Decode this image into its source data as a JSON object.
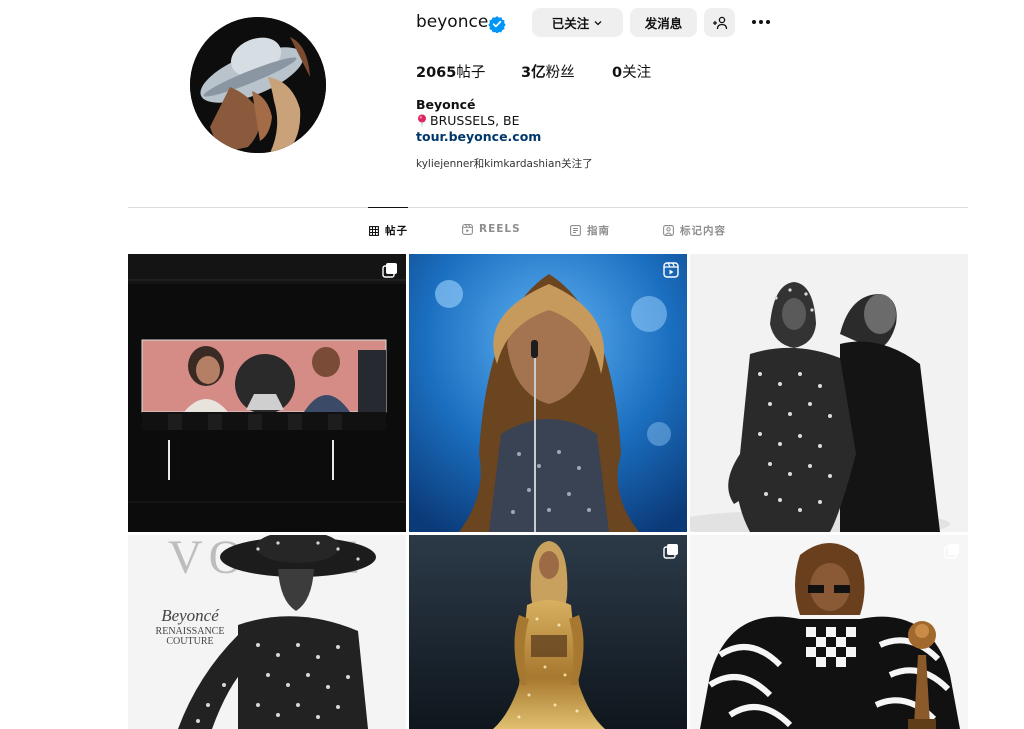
{
  "profile": {
    "username": "beyonce",
    "following_button": "已关注",
    "message_button": "发消息",
    "stats": {
      "posts": "2065",
      "posts_label": "帖子",
      "followers": "3亿",
      "followers_label": "粉丝",
      "following": "0",
      "following_label": "关注"
    },
    "full_name": "Beyoncé",
    "location": "BRUSSELS, BE",
    "link": "tour.beyonce.com",
    "followed_by": "kyliejenner和kimkardashian关注了"
  },
  "tabs": [
    {
      "label": "帖子",
      "icon": "grid-icon",
      "active": true
    },
    {
      "label": "REELS",
      "icon": "reels-icon",
      "active": false
    },
    {
      "label": "指南",
      "icon": "guide-icon",
      "active": false
    },
    {
      "label": "标记内容",
      "icon": "tagged-icon",
      "active": false
    }
  ],
  "posts": [
    {
      "badge": "multi-photo-icon",
      "scene": "concert screen with vintage photo"
    },
    {
      "badge": "reel-icon",
      "scene": "performer at microphone on blue stage"
    },
    {
      "badge": "",
      "scene": "black and white portrait in studded outfit"
    },
    {
      "badge": "",
      "scene": "magazine cover",
      "cover_title": "VOGUE",
      "cover_name": "Beyoncé",
      "cover_line1": "RENAISSANCE",
      "cover_line2": "COUTURE"
    },
    {
      "badge": "multi-photo-icon",
      "scene": "golden sequined gown on dark background"
    },
    {
      "badge": "multi-photo-icon",
      "scene": "checkered outfit with trophy"
    }
  ],
  "colors": {
    "link": "#00376b",
    "verified": "#0095f6",
    "button_bg": "#efefef",
    "divider": "#dbdbdb"
  }
}
